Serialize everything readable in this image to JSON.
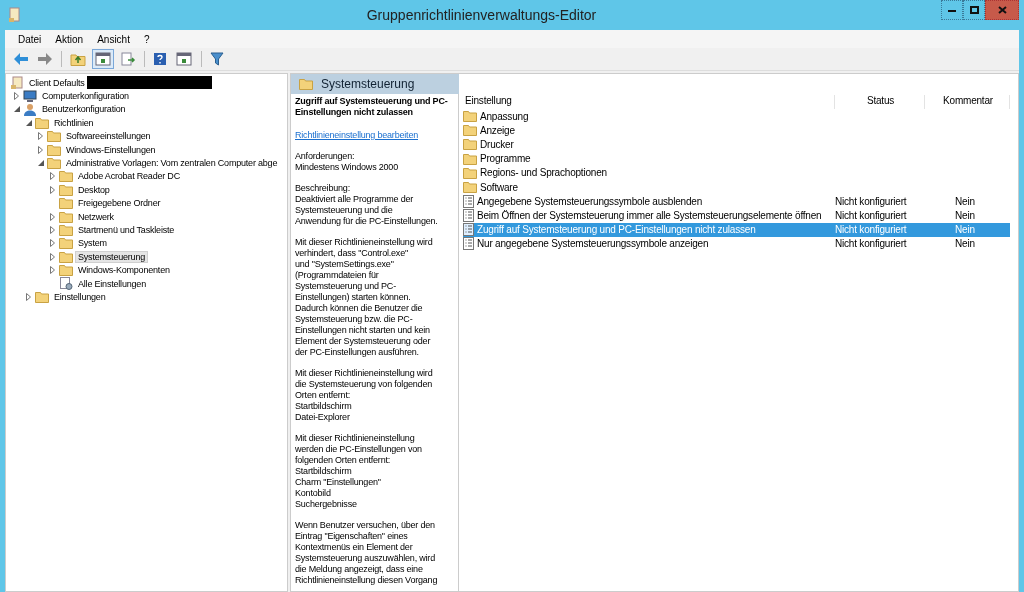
{
  "window": {
    "title": "Gruppenrichtlinienverwaltungs-Editor"
  },
  "menu": [
    "Datei",
    "Aktion",
    "Ansicht",
    "?"
  ],
  "toolbar": [
    {
      "kind": "back"
    },
    {
      "kind": "forward"
    },
    {
      "kind": "sep"
    },
    {
      "kind": "up"
    },
    {
      "kind": "pane",
      "selected": true
    },
    {
      "kind": "export"
    },
    {
      "kind": "sep"
    },
    {
      "kind": "help"
    },
    {
      "kind": "pane2"
    },
    {
      "kind": "sep"
    },
    {
      "kind": "filter"
    }
  ],
  "tree": {
    "root": {
      "label": "Client Defaults",
      "redacted": true
    },
    "items": [
      {
        "label": "Computerkonfiguration",
        "kind": "computer",
        "expanded": false,
        "selected": false
      },
      {
        "label": "Benutzerkonfiguration",
        "kind": "user",
        "expanded": true,
        "selected": false,
        "children": [
          {
            "label": "Richtlinien",
            "kind": "folder",
            "expanded": true,
            "selected": false,
            "children": [
              {
                "label": "Softwareeinstellungen",
                "kind": "folder",
                "expanded": false,
                "selected": false
              },
              {
                "label": "Windows-Einstellungen",
                "kind": "folder",
                "expanded": false,
                "selected": false
              },
              {
                "label": "Administrative Vorlagen: Vom zentralen Computer abge",
                "kind": "folder",
                "expanded": true,
                "selected": false,
                "children": [
                  {
                    "label": "Adobe Acrobat Reader DC",
                    "kind": "folder",
                    "expanded": false,
                    "selected": false
                  },
                  {
                    "label": "Desktop",
                    "kind": "folder",
                    "expanded": false,
                    "selected": false
                  },
                  {
                    "label": "Freigegebene Ordner",
                    "kind": "folder",
                    "selected": false
                  },
                  {
                    "label": "Netzwerk",
                    "kind": "folder",
                    "expanded": false,
                    "selected": false
                  },
                  {
                    "label": "Startmenü und Taskleiste",
                    "kind": "folder",
                    "expanded": false,
                    "selected": false
                  },
                  {
                    "label": "System",
                    "kind": "folder",
                    "expanded": false,
                    "selected": false
                  },
                  {
                    "label": "Systemsteuerung",
                    "kind": "folder",
                    "expanded": false,
                    "selected": true
                  },
                  {
                    "label": "Windows-Komponenten",
                    "kind": "folder",
                    "expanded": false,
                    "selected": false
                  },
                  {
                    "label": "Alle Einstellungen",
                    "kind": "settings",
                    "selected": false
                  }
                ]
              }
            ]
          },
          {
            "label": "Einstellungen",
            "kind": "folder",
            "expanded": false,
            "selected": false
          }
        ]
      }
    ]
  },
  "detail": {
    "header": "Systemsteuerung",
    "title": "Zugriff auf Systemsteuerung und PC-Einstellungen nicht zulassen",
    "link": "Richtlinieneinstellung bearbeiten",
    "paragraphs": [
      [
        "Anforderungen:",
        "Mindestens Windows 2000"
      ],
      [
        "Beschreibung:",
        "Deaktiviert alle Programme der",
        "Systemsteuerung und die",
        "Anwendung für die PC-Einstellungen."
      ],
      [
        "Mit dieser Richtlinieneinstellung wird",
        "verhindert, dass \"Control.exe\"",
        "und \"SystemSettings.exe\"",
        "(Programmdateien für",
        "Systemsteuerung und PC-",
        "Einstellungen) starten können.",
        "Dadurch können die Benutzer die",
        "Systemsteuerung bzw. die PC-",
        "Einstellungen nicht starten und kein",
        "Element der Systemsteuerung oder",
        "der PC-Einstellungen ausführen."
      ],
      [
        "Mit dieser Richtlinieneinstellung wird",
        "die Systemsteuerung von folgenden",
        "Orten entfernt:",
        "Startbildschirm",
        "Datei-Explorer"
      ],
      [
        "Mit dieser Richtlinieneinstellung",
        "werden die PC-Einstellungen von",
        "folgenden Orten entfernt:",
        "Startbildschirm",
        "Charm \"Einstellungen\"",
        "Kontobild",
        "Suchergebnisse"
      ],
      [
        "Wenn Benutzer versuchen, über den",
        "Eintrag \"Eigenschaften\" eines",
        "Kontextmenüs ein Element der",
        "Systemsteuerung auszuwählen, wird",
        "die Meldung angezeigt, dass eine",
        "Richtlinieneinstellung diesen Vorgang"
      ]
    ]
  },
  "table": {
    "columns": [
      "Einstellung",
      "Status",
      "Kommentar"
    ],
    "rows": [
      {
        "kind": "folder",
        "name": "Anpassung",
        "selected": false
      },
      {
        "kind": "folder",
        "name": "Anzeige",
        "selected": false
      },
      {
        "kind": "folder",
        "name": "Drucker",
        "selected": false
      },
      {
        "kind": "folder",
        "name": "Programme",
        "selected": false
      },
      {
        "kind": "folder",
        "name": "Regions- und Sprachoptionen",
        "selected": false
      },
      {
        "kind": "folder",
        "name": "Software",
        "selected": false
      },
      {
        "kind": "setting",
        "name": "Angegebene Systemsteuerungssymbole ausblenden",
        "status": "Nicht konfiguriert",
        "comment": "Nein",
        "selected": false
      },
      {
        "kind": "setting",
        "name": "Beim Öffnen der Systemsteuerung immer alle Systemsteuerungselemente öffnen",
        "status": "Nicht konfiguriert",
        "comment": "Nein",
        "selected": false
      },
      {
        "kind": "setting",
        "name": "Zugriff auf Systemsteuerung und PC-Einstellungen nicht zulassen",
        "status": "Nicht konfiguriert",
        "comment": "Nein",
        "selected": true
      },
      {
        "kind": "setting",
        "name": "Nur angegebene Systemsteuerungssymbole anzeigen",
        "status": "Nicht konfiguriert",
        "comment": "Nein",
        "selected": false
      }
    ]
  }
}
